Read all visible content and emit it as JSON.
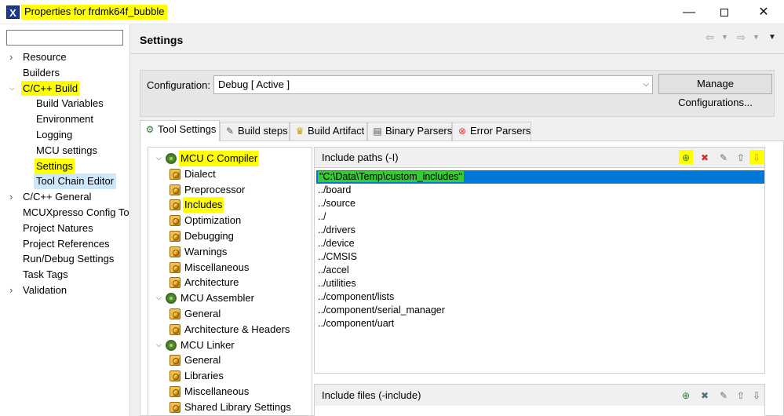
{
  "window": {
    "title": "Properties for frdmk64f_bubble",
    "app_icon": "x-app-icon",
    "controls": {
      "minimize": "—",
      "maximize": "",
      "close": "✕"
    }
  },
  "filter": {
    "placeholder": "",
    "value": ""
  },
  "nav": [
    {
      "label": "Resource",
      "level": 0,
      "expander": "right"
    },
    {
      "label": "Builders",
      "level": 0,
      "expander": "none"
    },
    {
      "label": "C/C++ Build",
      "level": 0,
      "expander": "down",
      "highlight": true
    },
    {
      "label": "Build Variables",
      "level": 1
    },
    {
      "label": "Environment",
      "level": 1
    },
    {
      "label": "Logging",
      "level": 1
    },
    {
      "label": "MCU settings",
      "level": 1
    },
    {
      "label": "Settings",
      "level": 1,
      "highlight": true
    },
    {
      "label": "Tool Chain Editor",
      "level": 1,
      "selected": true
    },
    {
      "label": "C/C++ General",
      "level": 0,
      "expander": "right"
    },
    {
      "label": "MCUXpresso Config To",
      "level": 0,
      "expander": "none"
    },
    {
      "label": "Project Natures",
      "level": 0,
      "expander": "none"
    },
    {
      "label": "Project References",
      "level": 0,
      "expander": "none"
    },
    {
      "label": "Run/Debug Settings",
      "level": 0,
      "expander": "none"
    },
    {
      "label": "Task Tags",
      "level": 0,
      "expander": "none"
    },
    {
      "label": "Validation",
      "level": 0,
      "expander": "right"
    }
  ],
  "settings": {
    "title": "Settings",
    "configuration_label": "Configuration:",
    "configuration_value": "Debug  [ Active ]",
    "manage_button": "Manage Configurations..."
  },
  "tabs": [
    {
      "label": "Tool Settings",
      "icon": "tool-settings-icon",
      "active": true
    },
    {
      "label": "Build steps",
      "icon": "build-steps-icon"
    },
    {
      "label": "Build Artifact",
      "icon": "build-artifact-icon"
    },
    {
      "label": "Binary Parsers",
      "icon": "binary-parsers-icon"
    },
    {
      "label": "Error Parsers",
      "icon": "error-parsers-icon"
    }
  ],
  "tool_tree": [
    {
      "label": "MCU C Compiler",
      "type": "tool",
      "highlight": true
    },
    {
      "label": "Dialect",
      "type": "option"
    },
    {
      "label": "Preprocessor",
      "type": "option"
    },
    {
      "label": "Includes",
      "type": "option",
      "highlight": true
    },
    {
      "label": "Optimization",
      "type": "option"
    },
    {
      "label": "Debugging",
      "type": "option"
    },
    {
      "label": "Warnings",
      "type": "option"
    },
    {
      "label": "Miscellaneous",
      "type": "option"
    },
    {
      "label": "Architecture",
      "type": "option"
    },
    {
      "label": "MCU Assembler",
      "type": "tool"
    },
    {
      "label": "General",
      "type": "option"
    },
    {
      "label": "Architecture & Headers",
      "type": "option"
    },
    {
      "label": "MCU Linker",
      "type": "tool"
    },
    {
      "label": "General",
      "type": "option"
    },
    {
      "label": "Libraries",
      "type": "option"
    },
    {
      "label": "Miscellaneous",
      "type": "option"
    },
    {
      "label": "Shared Library Settings",
      "type": "option"
    }
  ],
  "include_paths": {
    "title": "Include paths (-I)",
    "toolbar": [
      "add-icon",
      "delete-icon",
      "edit-icon",
      "move-up-icon",
      "move-down-icon"
    ],
    "paths": [
      "\"C:\\Data\\Temp\\custom_includes\"",
      "../board",
      "../source",
      "../",
      "../drivers",
      "../device",
      "../CMSIS",
      "../accel",
      "../utilities",
      "../component/lists",
      "../component/serial_manager",
      "../component/uart"
    ]
  },
  "include_files": {
    "title": "Include files (-include)",
    "toolbar": [
      "add-icon",
      "delete-icon",
      "edit-icon",
      "move-up-icon",
      "move-down-icon"
    ]
  },
  "colors": {
    "highlight": "#ffff00",
    "selection": "#0078d7",
    "selection_text_highlight": "#33cc33",
    "tree_selection": "#cce8ff"
  }
}
